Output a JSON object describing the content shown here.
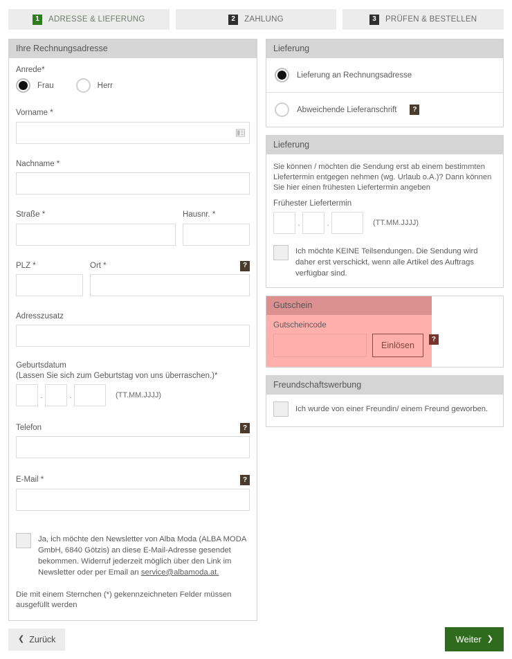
{
  "stepper": {
    "steps": [
      {
        "num": "1",
        "label": "ADRESSE & LIEFERUNG",
        "active": true
      },
      {
        "num": "2",
        "label": "ZAHLUNG",
        "active": false
      },
      {
        "num": "3",
        "label": "PRÜFEN & BESTELLEN",
        "active": false
      }
    ]
  },
  "colors": {
    "active_step": "#2f7d1f",
    "inactive_step": "#2f2f2f",
    "help_badge": "#4a3b2c",
    "voucher_highlight": "#ffb0ac",
    "voucher_header": "#dd9090",
    "primary_button": "#2f6b1c",
    "panel_header": "#d5d5d5"
  },
  "billing": {
    "title": "Ihre Rechnungsadresse",
    "salutation": {
      "label": "Anrede*",
      "options": [
        {
          "label": "Frau",
          "selected": true
        },
        {
          "label": "Herr",
          "selected": false
        }
      ]
    },
    "firstname": {
      "label": "Vorname *",
      "value": "",
      "icon": "contact-card-icon"
    },
    "lastname": {
      "label": "Nachname *",
      "value": ""
    },
    "street": {
      "label": "Straße *",
      "value": ""
    },
    "houseno": {
      "label": "Hausnr. *",
      "value": ""
    },
    "zip": {
      "label": "PLZ *",
      "value": ""
    },
    "city": {
      "label": "Ort *",
      "value": ""
    },
    "address_extra": {
      "label": "Adresszusatz",
      "value": ""
    },
    "birthdate": {
      "label": "Geburtsdatum\n(Lassen Sie sich zum Geburtstag von uns überraschen.)*",
      "label_line1": "Geburtsdatum",
      "label_line2": "(Lassen Sie sich zum Geburtstag von uns überraschen.)*",
      "day": "",
      "month": "",
      "year": "",
      "separator": ".",
      "hint": "(TT.MM.JJJJ)"
    },
    "phone": {
      "label": "Telefon",
      "value": ""
    },
    "email": {
      "label": "E-Mail *",
      "value": ""
    },
    "newsletter": {
      "checked": false,
      "text_before": "Ja, ich möchte den Newsletter von Alba Moda (ALBA MODA GmbH, 6840 Götzis) an diese E-Mail-Adresse gesendet bekommen. Widerruf jederzeit möglich über den Link im Newsletter oder per Email an ",
      "link": "service@albamoda.at."
    },
    "required_note": "Die mit einem Sternchen (*) gekennzeichneten Felder müssen ausgefüllt werden"
  },
  "delivery": {
    "title": "Lieferung",
    "options": [
      {
        "label": "Lieferung an Rechnungsadresse",
        "selected": true,
        "help": false
      },
      {
        "label": "Abweichende Lieferanschrift",
        "selected": false,
        "help": true
      }
    ]
  },
  "delivery_date": {
    "title": "Lieferung",
    "description": "Sie können / möchten die Sendung erst ab einem bestimmten Liefertermin entgegen nehmen (wg. Urlaub o.A.)? Dann können Sie hier einen frühesten Liefertermin angeben",
    "field_label": "Frühester Liefertermin",
    "day": "",
    "month": "",
    "year": "",
    "separator": ".",
    "hint": "(TT.MM.JJJJ)",
    "no_partial": {
      "checked": false,
      "text": "Ich möchte KEINE Teilsendungen. Die Sendung wird daher erst verschickt, wenn alle Artikel des Auftrags verfügbar sind."
    }
  },
  "voucher": {
    "title": "Gutschein",
    "label": "Gutscheincode",
    "value": "",
    "button": "Einlösen",
    "help": "?"
  },
  "referral": {
    "title": "Freundschaftswerbung",
    "checkbox": {
      "checked": false,
      "text": "Ich wurde von einer Freundin/ einem Freund geworben."
    }
  },
  "footer": {
    "back": "Zurück",
    "next": "Weiter",
    "back_chevron": "❮",
    "next_chevron": "❯"
  },
  "help_symbol": "?"
}
